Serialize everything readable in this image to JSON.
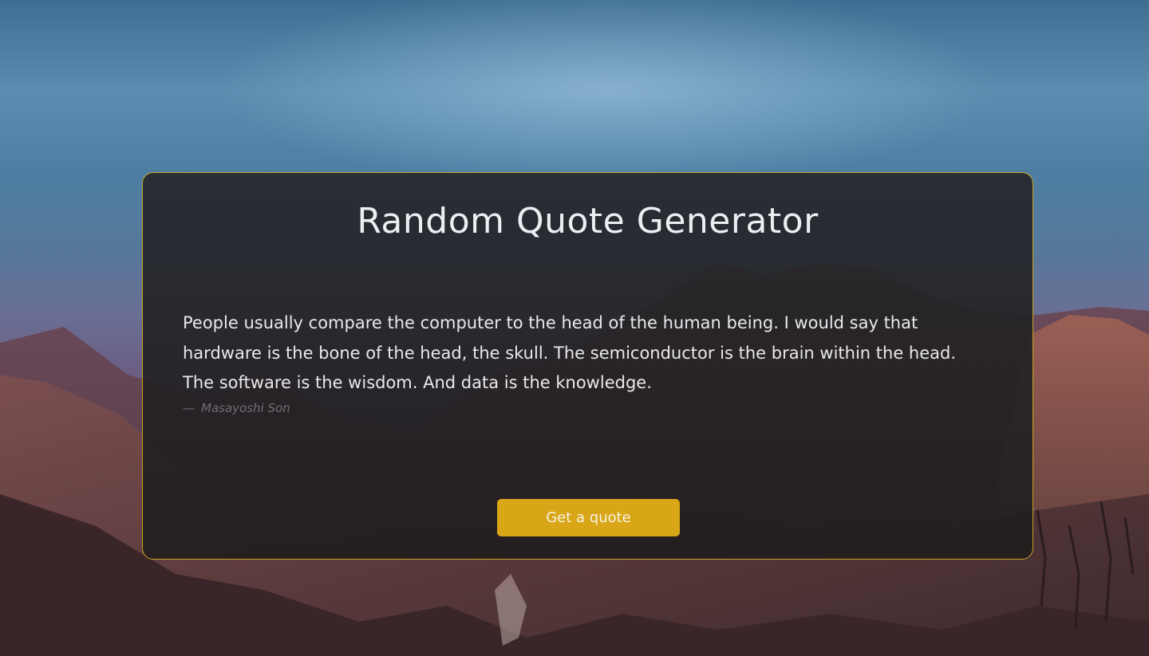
{
  "app": {
    "title": "Random Quote Generator"
  },
  "quote": {
    "text": "People usually compare the computer to the head of the human being. I would say that hardware is the bone of the head, the skull. The semiconductor is the brain within the head. The software is the wisdom. And data is the knowledge.",
    "dash": "—",
    "author": "Masayoshi Son"
  },
  "actions": {
    "get_quote_label": "Get a quote"
  },
  "colors": {
    "accent": "#d8a616",
    "card_border": "#c9a227",
    "title_text": "#eceef2",
    "author_text": "#6f6e73"
  },
  "background": {
    "scene": "mountain-landscape-image"
  }
}
